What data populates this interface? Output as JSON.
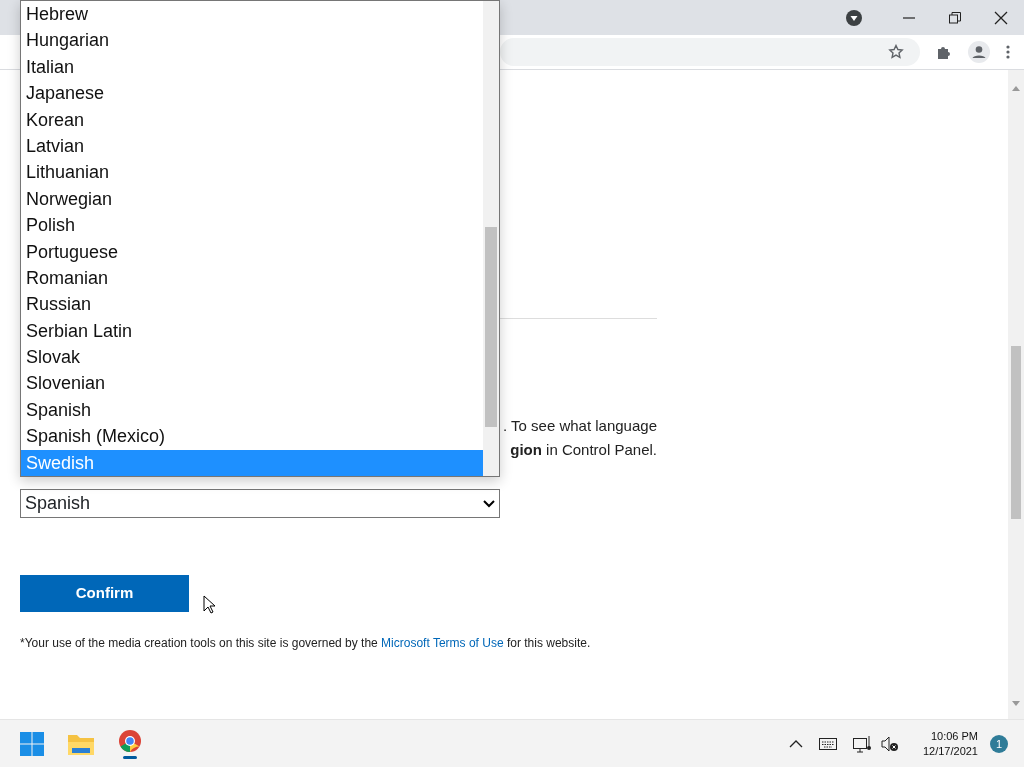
{
  "language_list": {
    "items": [
      {
        "label": "Hebrew",
        "selected": false
      },
      {
        "label": "Hungarian",
        "selected": false
      },
      {
        "label": "Italian",
        "selected": false
      },
      {
        "label": "Japanese",
        "selected": false
      },
      {
        "label": "Korean",
        "selected": false
      },
      {
        "label": "Latvian",
        "selected": false
      },
      {
        "label": "Lithuanian",
        "selected": false
      },
      {
        "label": "Norwegian",
        "selected": false
      },
      {
        "label": "Polish",
        "selected": false
      },
      {
        "label": "Portuguese",
        "selected": false
      },
      {
        "label": "Romanian",
        "selected": false
      },
      {
        "label": "Russian",
        "selected": false
      },
      {
        "label": "Serbian Latin",
        "selected": false
      },
      {
        "label": "Slovak",
        "selected": false
      },
      {
        "label": "Slovenian",
        "selected": false
      },
      {
        "label": "Spanish",
        "selected": false
      },
      {
        "label": "Spanish (Mexico)",
        "selected": false
      },
      {
        "label": "Swedish",
        "selected": true
      }
    ]
  },
  "info_text": [
    ". To see what language",
    "**gion** in Control Panel."
  ],
  "language_select": {
    "value": "Spanish"
  },
  "confirm_button": "Confirm",
  "terms": {
    "before": "*Your use of the media creation tools on this site is governed by the ",
    "link": "Microsoft Terms of Use",
    "after": " for this website."
  },
  "taskbar": {
    "time": "10:06 PM",
    "date": "12/17/2021",
    "notification_count": "1"
  }
}
